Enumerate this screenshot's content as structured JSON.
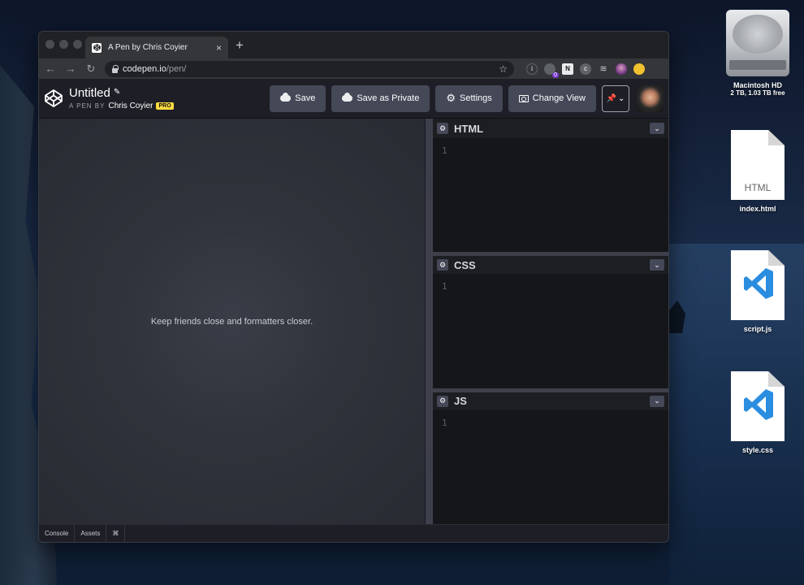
{
  "browser": {
    "tab_title": "A Pen by Chris Coyier",
    "url_domain": "codepen.io",
    "url_path": "/pen/",
    "extension_badge": "0"
  },
  "codepen": {
    "pen_title": "Untitled",
    "pen_by_label": "A PEN BY",
    "author": "Chris Coyier",
    "pro_label": "PRO",
    "buttons": {
      "save": "Save",
      "save_private": "Save as Private",
      "settings": "Settings",
      "change_view": "Change View"
    },
    "preview_message": "Keep friends close and formatters closer.",
    "editors": [
      {
        "title": "HTML",
        "line": "1"
      },
      {
        "title": "CSS",
        "line": "1"
      },
      {
        "title": "JS",
        "line": "1"
      }
    ],
    "footer": {
      "console": "Console",
      "assets": "Assets",
      "shortcuts": "⌘"
    }
  },
  "desktop": {
    "hdd": {
      "name": "Macintosh HD",
      "sub": "2 TB, 1.03 TB free"
    },
    "files": [
      {
        "name": "index.html",
        "doc_label": "HTML"
      },
      {
        "name": "script.js"
      },
      {
        "name": "style.css"
      }
    ]
  },
  "colors": {
    "pro_badge": "#ffdd40",
    "button_bg": "#444857",
    "editor_bg": "#151619",
    "vscode_blue": "#2a8de0"
  }
}
